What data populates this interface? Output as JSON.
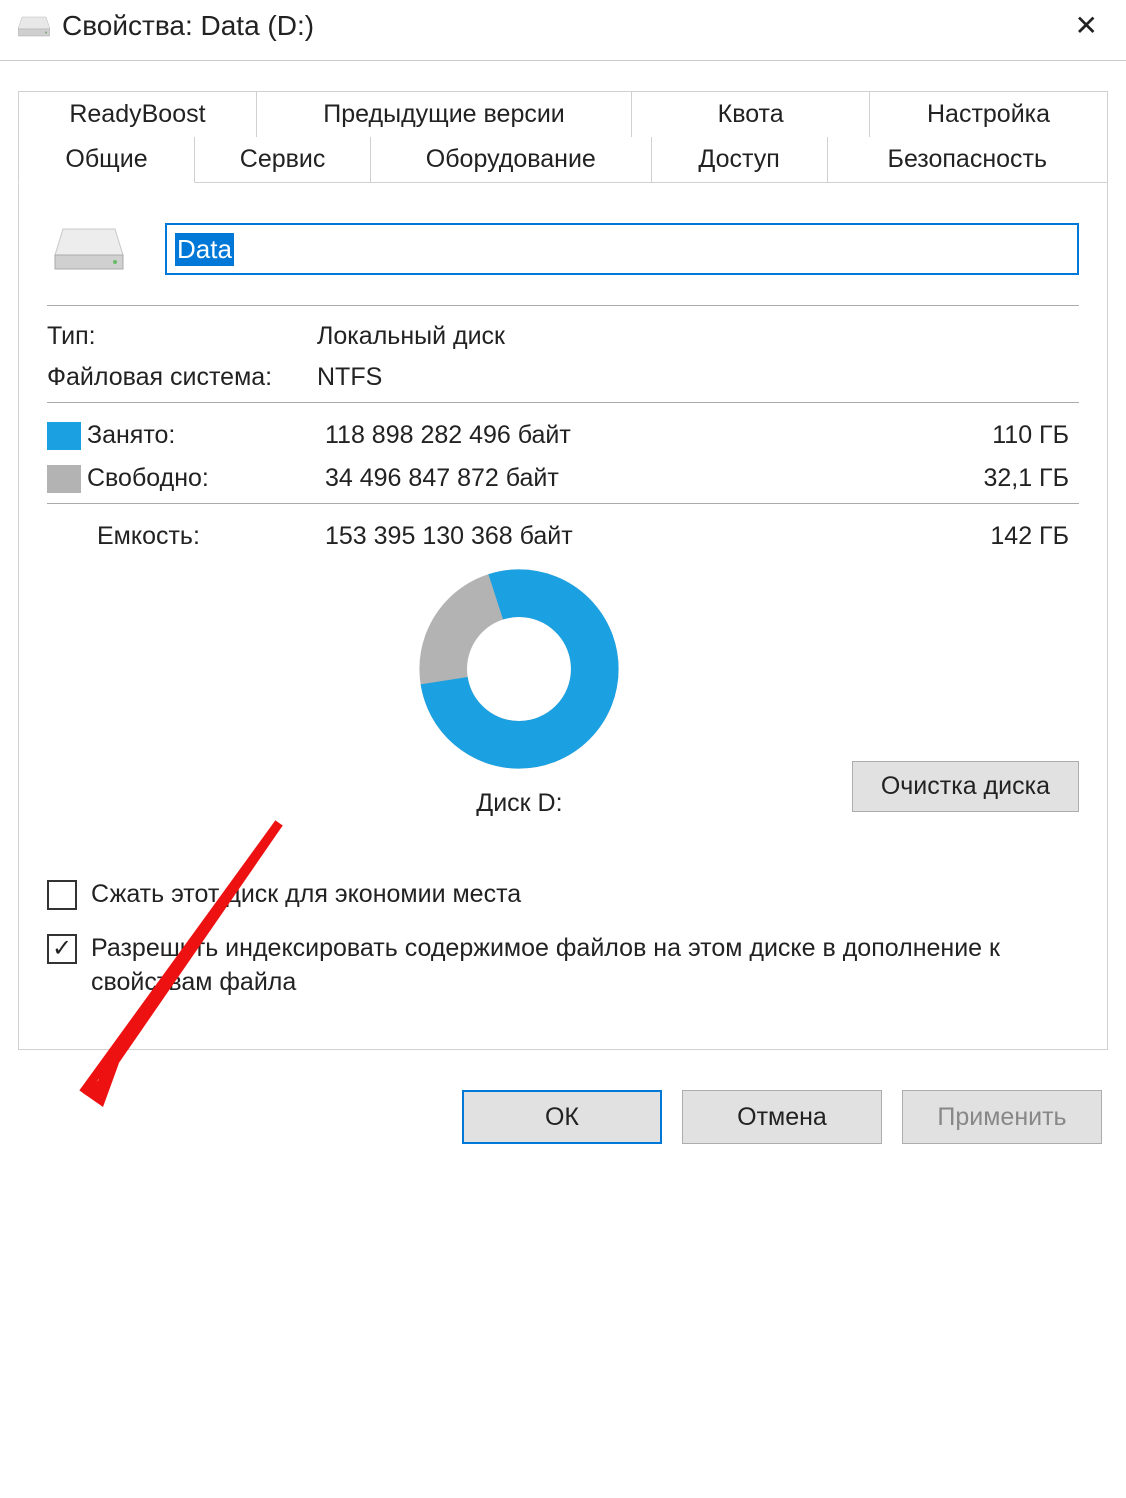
{
  "window": {
    "title": "Свойства: Data (D:)"
  },
  "tabs": {
    "row1": [
      "ReadyBoost",
      "Предыдущие версии",
      "Квота",
      "Настройка"
    ],
    "row2": [
      "Общие",
      "Сервис",
      "Оборудование",
      "Доступ",
      "Безопасность"
    ],
    "active": "Общие"
  },
  "general": {
    "name_value": "Data",
    "type_label": "Тип:",
    "type_value": "Локальный диск",
    "fs_label": "Файловая система:",
    "fs_value": "NTFS",
    "used_label": "Занято:",
    "used_bytes": "118 898 282 496 байт",
    "used_gb": "110 ГБ",
    "free_label": "Свободно:",
    "free_bytes": "34 496 847 872 байт",
    "free_gb": "32,1 ГБ",
    "cap_label": "Емкость:",
    "cap_bytes": "153 395 130 368 байт",
    "cap_gb": "142 ГБ",
    "disk_label": "Диск D:",
    "cleanup_button": "Очистка диска",
    "compress_label": "Сжать этот диск для экономии места",
    "index_label": "Разрешить индексировать содержимое файлов на этом диске в дополнение к свойствам файла"
  },
  "chart_data": {
    "type": "pie",
    "title": "Диск D:",
    "series": [
      {
        "name": "Занято",
        "value": 118898282496,
        "color": "#1ba1e2"
      },
      {
        "name": "Свободно",
        "value": 34496847872,
        "color": "#b3b3b3"
      }
    ],
    "total": 153395130368
  },
  "buttons": {
    "ok": "ОК",
    "cancel": "Отмена",
    "apply": "Применить"
  },
  "colors": {
    "used": "#1ba1e2",
    "free": "#b3b3b3",
    "accent": "#0078d7",
    "arrow": "#e11"
  }
}
